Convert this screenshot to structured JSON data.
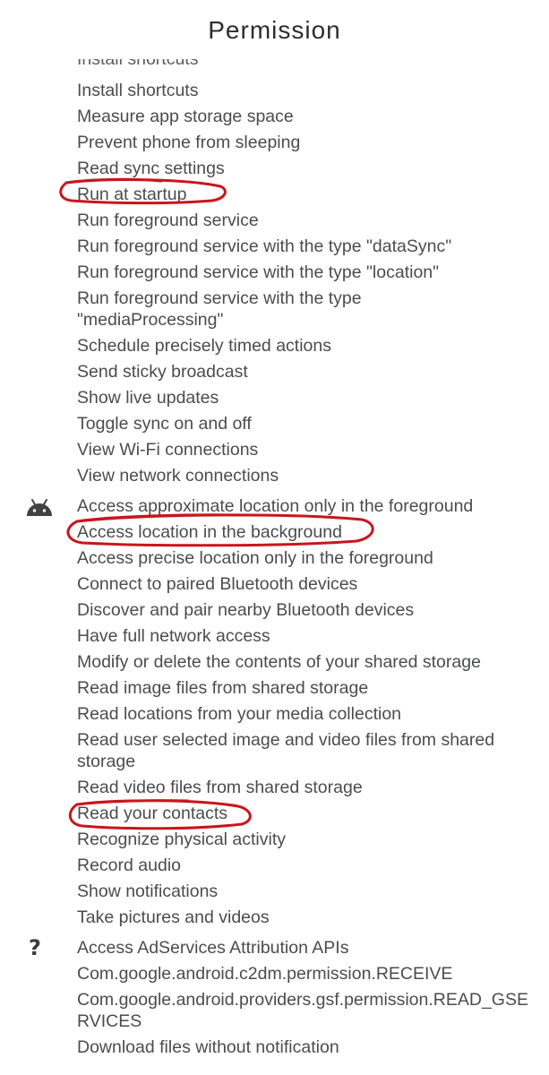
{
  "title": "Permission",
  "groups": [
    {
      "icon": "none",
      "items": [
        "Install shortcuts",
        "Measure app storage space",
        "Prevent phone from sleeping",
        "Read sync settings",
        "Run at startup",
        "Run foreground service",
        "Run foreground service with the type \"dataSync\"",
        "Run foreground service with the type \"location\"",
        "Run foreground service with the type \"mediaProcessing\"",
        "Schedule precisely timed actions",
        "Send sticky broadcast",
        "Show live updates",
        "Toggle sync on and off",
        "View Wi-Fi connections",
        "View network connections"
      ]
    },
    {
      "icon": "android-icon",
      "items": [
        "Access approximate location only in the foreground",
        "Access location in the background",
        "Access precise location only in the foreground",
        "Connect to paired Bluetooth devices",
        "Discover and pair nearby Bluetooth devices",
        "Have full network access",
        "Modify or delete the contents of your shared storage",
        "Read image files from shared storage",
        "Read locations from your media collection",
        "Read user selected image and video files from shared storage",
        "Read video files from shared storage",
        "Read your contacts",
        "Recognize physical activity",
        "Record audio",
        "Show notifications",
        "Take pictures and videos"
      ]
    },
    {
      "icon": "question-icon",
      "icon_text": "?",
      "items": [
        "Access AdServices Attribution APIs",
        "Com.google.android.c2dm.permission.RECEIVE",
        "Com.google.android.providers.gsf.permission.READ_GSERVICES",
        "Download files without notification"
      ]
    }
  ],
  "annotation_color": "#c8161d"
}
